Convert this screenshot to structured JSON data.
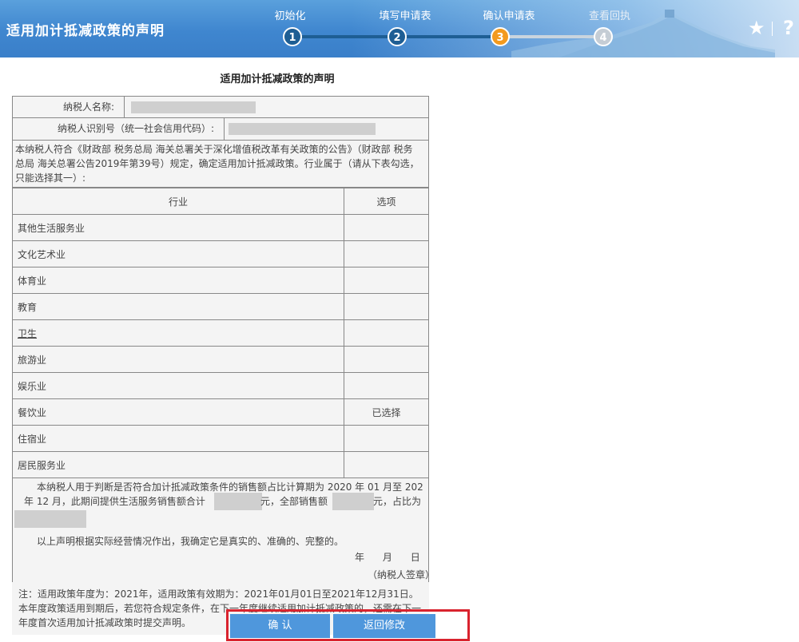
{
  "header": {
    "title": "适用加计抵减政策的声明",
    "steps": [
      {
        "number": "1",
        "label": "初始化",
        "state": "done"
      },
      {
        "number": "2",
        "label": "填写申请表",
        "state": "done"
      },
      {
        "number": "3",
        "label": "确认申请表",
        "state": "current"
      },
      {
        "number": "4",
        "label": "查看回执",
        "state": "todo"
      }
    ],
    "favorite_icon": "star-icon",
    "favorite_glyph": "★",
    "help_icon": "help-icon",
    "help_glyph": "?",
    "colors": {
      "header_blue": "#3f86cf",
      "step_done": "#1e5e94",
      "step_current": "#f39a1e",
      "step_todo": "#c5cdd5"
    }
  },
  "form": {
    "title": "适用加计抵减政策的声明",
    "taxpayer_name_label": "纳税人名称:",
    "taxpayer_id_label": "纳税人识别号（统一社会信用代码）:",
    "statement_line1": "本纳税人符合《财政部 税务总局 海关总署关于深化增值税改革有关政策的公告》（财政部 税务",
    "statement_line2": "总局 海关总署公告2019年第39号）规定，确定适用加计抵减政策。行业属于（请从下表勾选，",
    "statement_line3": "只能选择其一）:",
    "table": {
      "headers": [
        "行业",
        "选项"
      ],
      "rows": [
        {
          "industry": "其他生活服务业",
          "option": ""
        },
        {
          "industry": "文化艺术业",
          "option": ""
        },
        {
          "industry": "体育业",
          "option": ""
        },
        {
          "industry": "教育",
          "option": ""
        },
        {
          "industry": "卫生",
          "option": ""
        },
        {
          "industry": "旅游业",
          "option": ""
        },
        {
          "industry": "娱乐业",
          "option": ""
        },
        {
          "industry": "餐饮业",
          "option": "已选择"
        },
        {
          "industry": "住宿业",
          "option": ""
        },
        {
          "industry": "居民服务业",
          "option": ""
        }
      ]
    },
    "period_line1": "本纳税人用于判断是否符合加计抵减政策条件的销售额占比计算期为  2020  年  01  月至  202",
    "period_line2_a": "年  12  月，此期间提供生活服务销售额合计",
    "period_line2_b": "元，全部销售额",
    "period_line2_c": "元，占比为",
    "declaration": "以上声明根据实际经营情况作出，我确定它是真实的、准确的、完整的。",
    "date_line": "年      月      日",
    "signature": "（纳税人签章）",
    "note_line1": "注：适用政策年度为：2021年，适用政策有效期为：2021年01月01日至2021年12月31日。",
    "note_line2": "本年度政策适用到期后，若您符合规定条件，在下一年度继续适用加计抵减政策的，还需在下一",
    "note_line3": "年度首次适用加计抵减政策时提交声明。"
  },
  "actions": {
    "confirm_label": "确  认",
    "back_label": "返回修改"
  }
}
